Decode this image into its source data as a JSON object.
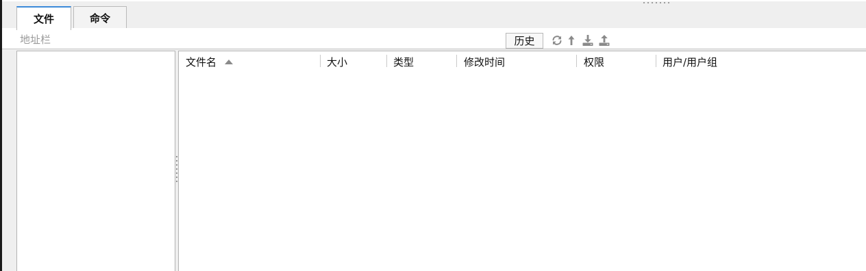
{
  "tabs": [
    {
      "label": "文件",
      "active": true
    },
    {
      "label": "命令",
      "active": false
    }
  ],
  "address_bar": {
    "placeholder": "地址栏",
    "value": ""
  },
  "toolbar": {
    "history_label": "历史",
    "icons": [
      "refresh-icon",
      "up-directory-icon",
      "download-icon",
      "upload-icon"
    ]
  },
  "file_table": {
    "columns": [
      {
        "label": "文件名",
        "sorted": "ascending"
      },
      {
        "label": "大小"
      },
      {
        "label": "类型"
      },
      {
        "label": "修改时间"
      },
      {
        "label": "权限"
      },
      {
        "label": "用户/用户组"
      }
    ],
    "rows": []
  },
  "colors": {
    "active_tab_accent": "#3b8ad9",
    "border": "#b3b3b3",
    "icon_gray": "#8a8a8a"
  }
}
